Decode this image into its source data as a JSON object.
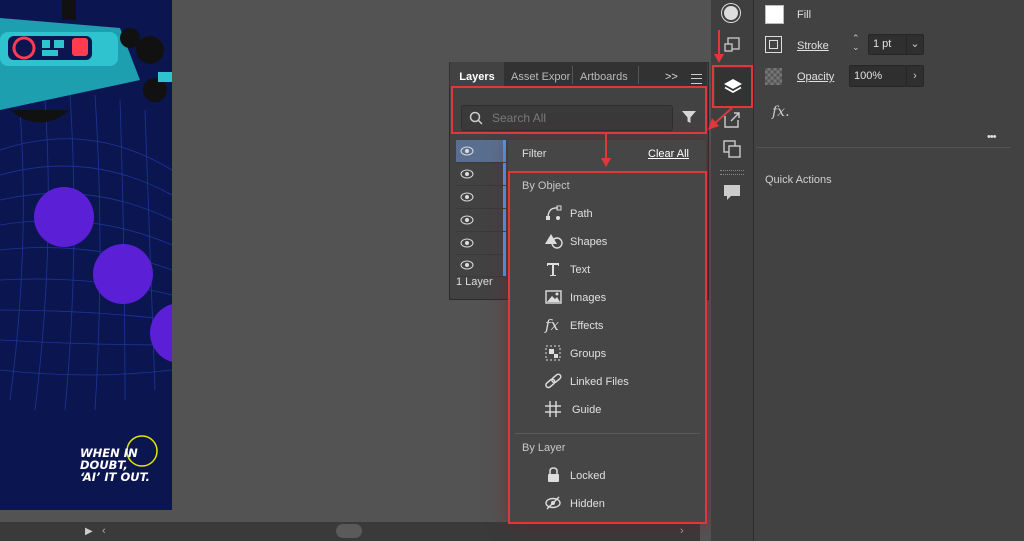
{
  "artboard": {
    "tagline_line1_a": "WHEN ",
    "tagline_line1_b": "IN",
    "tagline_line2": "DOUBT,",
    "tagline_line3": "‘AI’ IT OUT.",
    "colors": {
      "background": "#0b1650",
      "circle": "#5b1fd6",
      "robot": "#1aa7b7"
    }
  },
  "layers_panel": {
    "tabs": [
      "Layers",
      "Asset Expor",
      "Artboards"
    ],
    "overflow_label": ">>",
    "search_placeholder": "Search All",
    "footer": "1 Layer"
  },
  "filter_menu": {
    "title": "Filter",
    "clear_all": "Clear All",
    "by_object_heading": "By Object",
    "by_object_items": [
      {
        "label": "Path",
        "icon": "path-icon"
      },
      {
        "label": "Shapes",
        "icon": "shapes-icon"
      },
      {
        "label": "Text",
        "icon": "text-icon"
      },
      {
        "label": "Images",
        "icon": "image-icon"
      },
      {
        "label": "Effects",
        "icon": "fx-icon"
      },
      {
        "label": "Groups",
        "icon": "groups-icon"
      },
      {
        "label": "Linked Files",
        "icon": "link-icon"
      },
      {
        "label": "Guide",
        "icon": "guide-icon"
      }
    ],
    "by_layer_heading": "By Layer",
    "by_layer_items": [
      {
        "label": "Locked",
        "icon": "lock-icon"
      },
      {
        "label": "Hidden",
        "icon": "hidden-eye-icon"
      }
    ]
  },
  "properties": {
    "fill_label": "Fill",
    "stroke_label": "Stroke",
    "stroke_value": "1 pt",
    "opacity_label": "Opacity",
    "opacity_value": "100%",
    "fx_label": "fx.",
    "more_label": "•••",
    "quick_actions_label": "Quick Actions"
  },
  "annotation_color": "#e0373b"
}
